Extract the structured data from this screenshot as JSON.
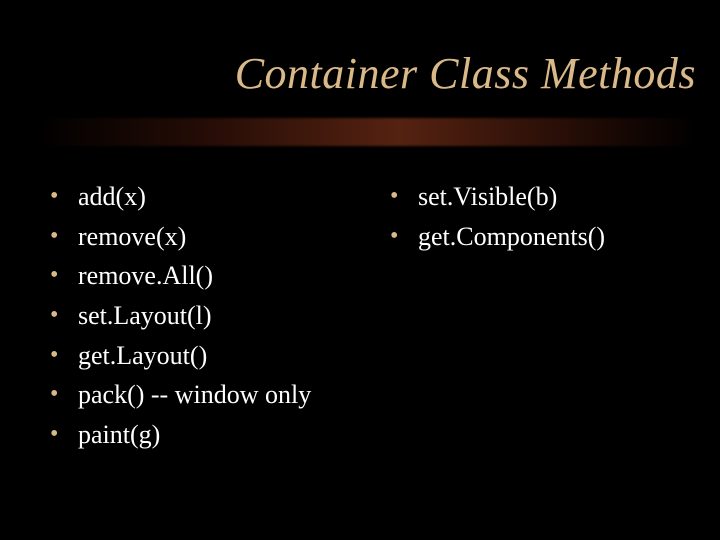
{
  "title": "Container Class Methods",
  "bullet_glyph": "•",
  "left_column": [
    "add(x)",
    "remove(x)",
    "remove.All()",
    "set.Layout(l)",
    "get.Layout()",
    "pack() -- window only",
    "paint(g)"
  ],
  "right_column": [
    "set.Visible(b)",
    "get.Components()"
  ],
  "colors": {
    "background": "#000000",
    "title": "#d9b988",
    "bullet": "#d9b988",
    "text": "#ffffff"
  }
}
